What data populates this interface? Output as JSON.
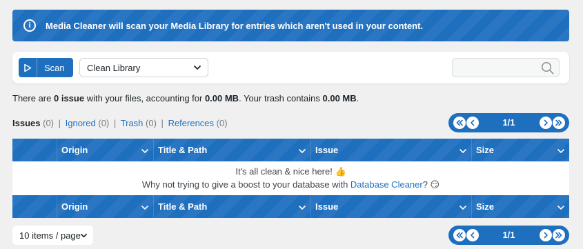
{
  "notice": {
    "icon": "info-icon",
    "text": "Media Cleaner will scan your Media Library for entries which aren't used in your content."
  },
  "toolbar": {
    "scan_label": "Scan",
    "method_select": {
      "selected": "Clean Library"
    },
    "search": {
      "value": "",
      "placeholder": ""
    }
  },
  "summary": {
    "prefix": "There are ",
    "issue_count": "0 issue",
    "middle": " with your files, accounting for ",
    "files_size": "0.00 MB",
    "trash_prefix": ". Your trash contains ",
    "trash_size": "0.00 MB",
    "suffix": "."
  },
  "filters": [
    {
      "label": "Issues",
      "count": "(0)",
      "active": true
    },
    {
      "label": "Ignored",
      "count": "(0)",
      "active": false
    },
    {
      "label": "Trash",
      "count": "(0)",
      "active": false
    },
    {
      "label": "References",
      "count": "(0)",
      "active": false
    }
  ],
  "pagination": {
    "pages": "1/1"
  },
  "table": {
    "columns": [
      "Origin",
      "Title & Path",
      "Issue",
      "Size"
    ],
    "empty": {
      "line1": "It's all clean & nice here! 👍",
      "line2_prefix": "Why not trying to give a boost to your database with ",
      "line2_link": "Database Cleaner",
      "line2_suffix": "? 😏"
    }
  },
  "per_page": {
    "selected": "10 items / page"
  },
  "colors": {
    "accent": "#1f6fbf",
    "background": "#f0f0f1",
    "link": "#1f6fbf"
  }
}
